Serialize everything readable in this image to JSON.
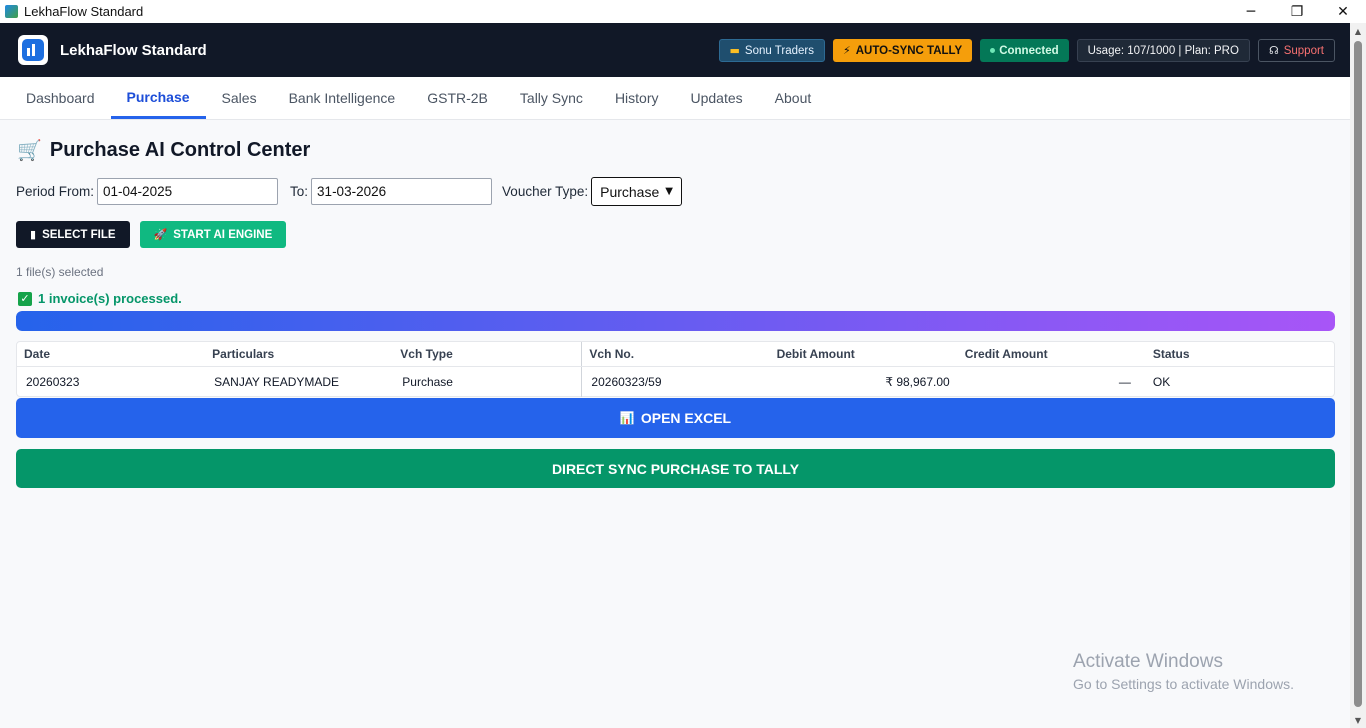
{
  "window": {
    "title": "LekhaFlow Standard",
    "minimize": "─",
    "restore": "❐",
    "close": "✕"
  },
  "header": {
    "brand": "LekhaFlow Standard",
    "company": "Sonu Traders",
    "company_icon": "folder-icon",
    "autosync": "AUTO-SYNC TALLY",
    "autosync_icon": "bolt-icon",
    "connected": "Connected",
    "usage": "Usage: 107/1000 | Plan: PRO",
    "support": "Support",
    "support_icon": "headset-icon"
  },
  "tabs": [
    {
      "label": "Dashboard"
    },
    {
      "label": "Purchase"
    },
    {
      "label": "Sales"
    },
    {
      "label": "Bank Intelligence"
    },
    {
      "label": "GSTR-2B"
    },
    {
      "label": "Tally Sync"
    },
    {
      "label": "History"
    },
    {
      "label": "Updates"
    },
    {
      "label": "About"
    }
  ],
  "active_tab": "Purchase",
  "main": {
    "title": "Purchase AI Control Center",
    "period_from_label": "Period From:",
    "period_from": "01-04-2025",
    "to_label": "To:",
    "to": "31-03-2026",
    "voucher_type_label": "Voucher Type:",
    "voucher_type": "Purchase",
    "select_file": "SELECT FILE",
    "start_engine": "START AI ENGINE",
    "files_selected": "1 file(s) selected",
    "processed": "1 invoice(s) processed.",
    "progress": 1.0,
    "open_excel": "OPEN EXCEL",
    "direct_sync": "DIRECT SYNC PURCHASE TO TALLY"
  },
  "table": {
    "columns": [
      "Date",
      "Particulars",
      "Vch Type",
      "Vch No.",
      "Debit Amount",
      "Credit Amount",
      "Status"
    ],
    "rows": [
      [
        "20260323",
        "SANJAY READYMADE",
        "Purchase",
        "20260323/59",
        "₹ 98,967.00",
        "—",
        "OK"
      ]
    ]
  },
  "watermark": {
    "line1": "Activate Windows",
    "line2": "Go to Settings to activate Windows."
  },
  "colors": {
    "header_bg": "#111827",
    "accent_blue": "#2563eb",
    "sync_green": "#059669",
    "autosync_orange": "#f59e0b"
  }
}
